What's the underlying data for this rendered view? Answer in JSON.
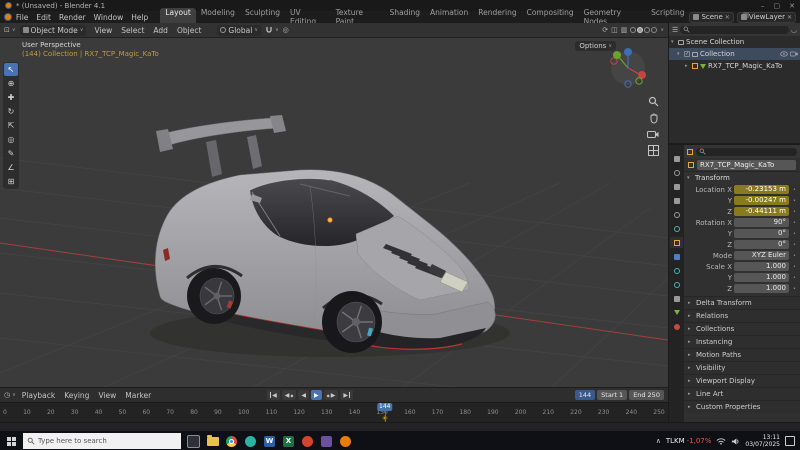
{
  "colors": {
    "accent": "#4772b3",
    "object_orange": "#e87d0d",
    "keyed_field": "#8a7a1e",
    "axis_red": "#b4413c"
  },
  "title_bar": {
    "title": "* (Unsaved) - Blender 4.1"
  },
  "menu_bar": {
    "menus": [
      "File",
      "Edit",
      "Render",
      "Window",
      "Help"
    ],
    "workspaces": [
      "Layout",
      "Modeling",
      "Sculpting",
      "UV Editing",
      "Texture Paint",
      "Shading",
      "Animation",
      "Rendering",
      "Compositing",
      "Geometry Nodes",
      "Scripting"
    ],
    "active_workspace": "Layout",
    "scene_label": "Scene",
    "view_layer_label": "ViewLayer"
  },
  "tool_header": {
    "mode": "Object Mode",
    "menus": [
      "View",
      "Select",
      "Add",
      "Object"
    ],
    "orientation": "Global"
  },
  "viewport": {
    "perspective_label": "User Perspective",
    "breadcrumb": "(144) Collection | RX7_TCP_Magic_KaTo",
    "options_label": "Options"
  },
  "outliner": {
    "rows": [
      {
        "label": "Scene Collection"
      },
      {
        "label": "Collection"
      },
      {
        "label": "RX7_TCP_Magic_KaTo"
      }
    ]
  },
  "properties": {
    "object_name": "RX7_TCP_Magic_KaTo",
    "transform_label": "Transform",
    "rows": [
      {
        "label": "Location X",
        "value": "-0.23153 m",
        "keyed": true
      },
      {
        "label": "Y",
        "value": "-0.00247 m",
        "keyed": true
      },
      {
        "label": "Z",
        "value": "-0.44111 m",
        "keyed": true
      },
      {
        "label": "Rotation X",
        "value": "90°",
        "keyed": false
      },
      {
        "label": "Y",
        "value": "0°",
        "keyed": false
      },
      {
        "label": "Z",
        "value": "0°",
        "keyed": false
      },
      {
        "label": "Mode",
        "value": "XYZ Euler",
        "keyed": false
      },
      {
        "label": "Scale X",
        "value": "1.000",
        "keyed": false
      },
      {
        "label": "Y",
        "value": "1.000",
        "keyed": false
      },
      {
        "label": "Z",
        "value": "1.000",
        "keyed": false
      }
    ],
    "sections": [
      "Delta Transform",
      "Relations",
      "Collections",
      "Instancing",
      "Motion Paths",
      "Visibility",
      "Viewport Display",
      "Line Art",
      "Custom Properties"
    ]
  },
  "timeline": {
    "menus": [
      "Playback",
      "Keying",
      "View",
      "Marker"
    ],
    "current_frame": "144",
    "frame_max": 250,
    "start_label": "Start",
    "start_value": "1",
    "end_label": "End",
    "end_value": "250",
    "ticks": [
      "0",
      "10",
      "20",
      "30",
      "40",
      "50",
      "60",
      "70",
      "80",
      "90",
      "100",
      "110",
      "120",
      "130",
      "140",
      "150",
      "160",
      "170",
      "180",
      "190",
      "200",
      "210",
      "220",
      "230",
      "240",
      "250"
    ]
  },
  "taskbar": {
    "search_placeholder": "Type here to search",
    "stock_ticker": "TLKM",
    "stock_change": "-1,07%",
    "time": "13:11",
    "date": "03/07/2025"
  },
  "icons": {
    "chevron_down": "∨",
    "chevron_right": "▸",
    "chevron_open": "▾",
    "close": "✕",
    "minimize": "–",
    "maximize": "▢",
    "play": "▶",
    "play_back": "◀",
    "dot": "•",
    "diamond": "◆",
    "check": "✓",
    "tray_up": "∧",
    "search_glyph": "⌕"
  }
}
